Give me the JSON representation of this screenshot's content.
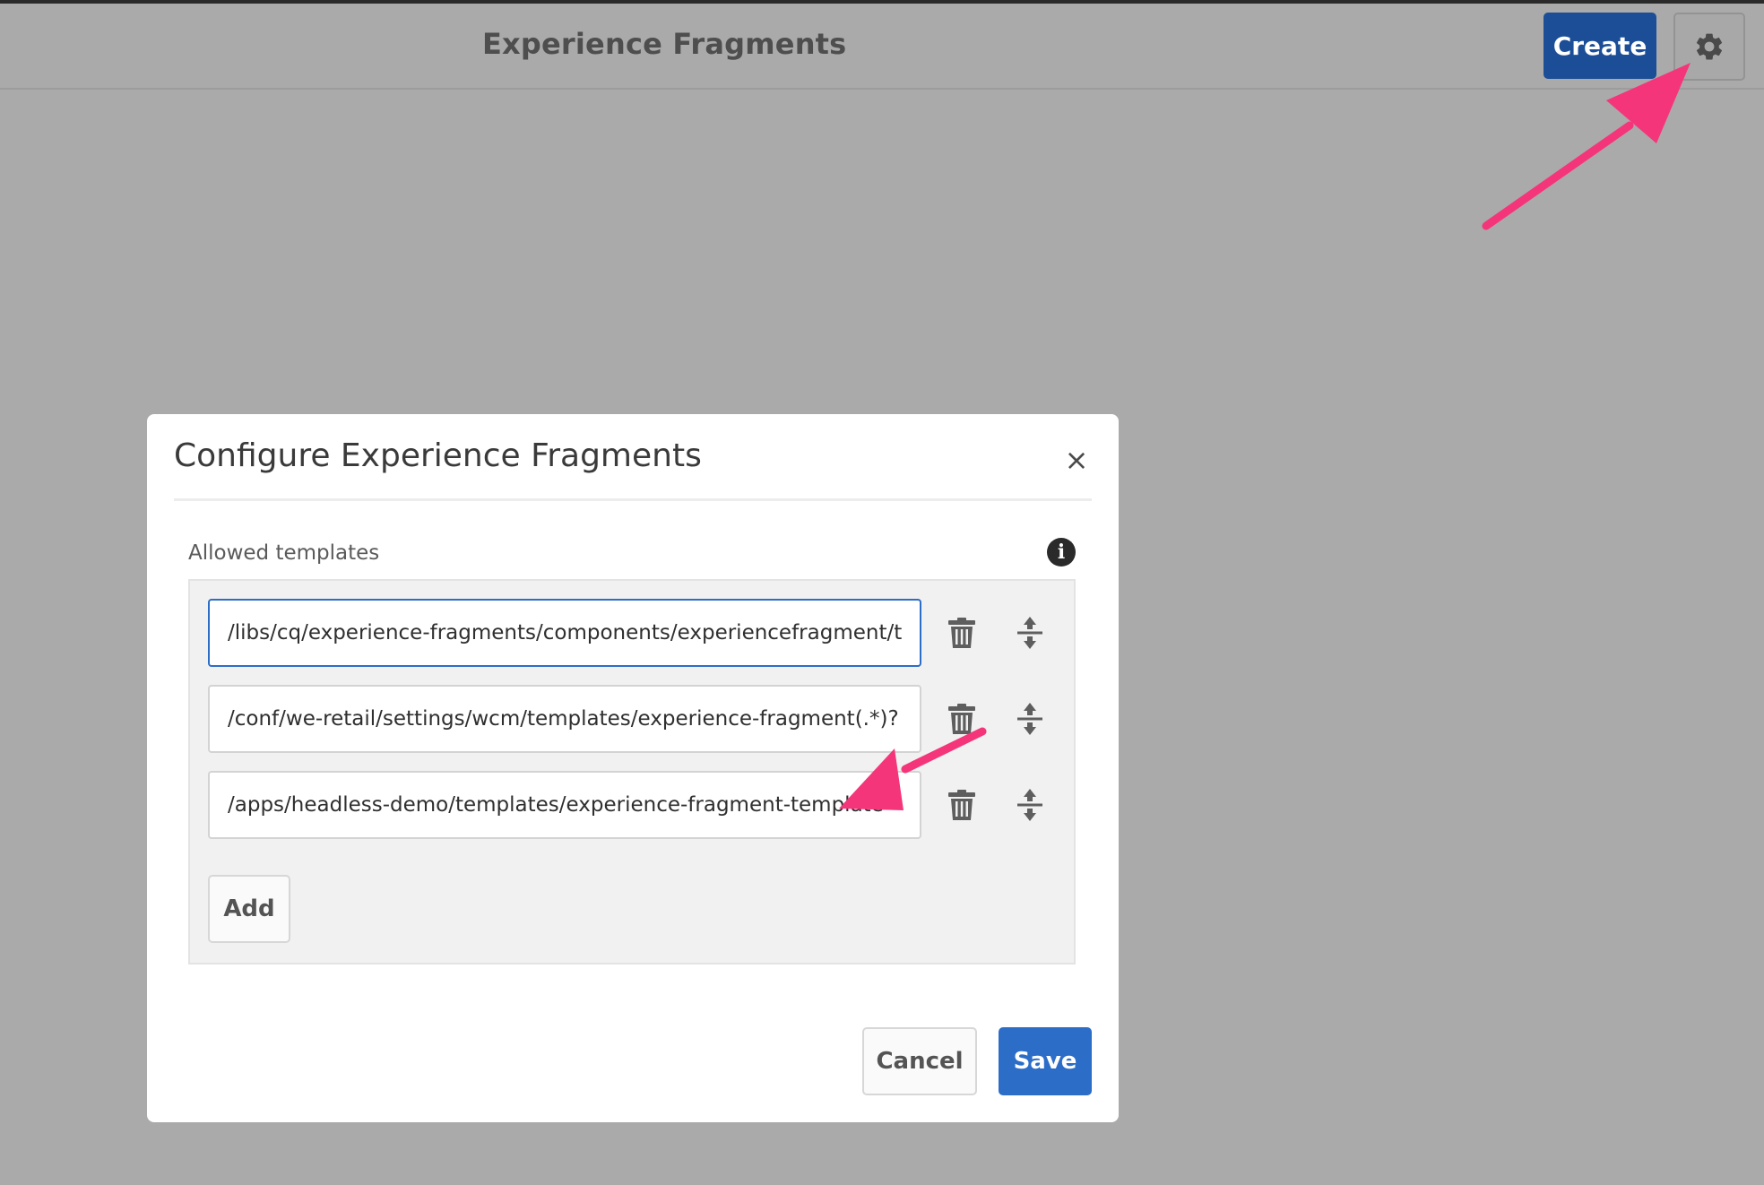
{
  "header": {
    "title": "Experience Fragments",
    "create_label": "Create",
    "settings_icon": "gear-icon"
  },
  "dialog": {
    "title": "Configure Experience Fragments",
    "close_icon": "close-icon",
    "close_glyph": "×",
    "field_label": "Allowed templates",
    "info_icon": "info-icon",
    "info_glyph": "i",
    "templates": [
      "/libs/cq/experience-fragments/components/experiencefragment/template",
      "/conf/we-retail/settings/wcm/templates/experience-fragment(.*)?",
      "/apps/headless-demo/templates/experience-fragment-template"
    ],
    "add_label": "Add",
    "cancel_label": "Cancel",
    "save_label": "Save"
  },
  "colors": {
    "backdrop": "#aaaaaa",
    "primary": "#1b4e97",
    "save": "#2c6dc8",
    "annotation_arrow": "#f5357a"
  }
}
